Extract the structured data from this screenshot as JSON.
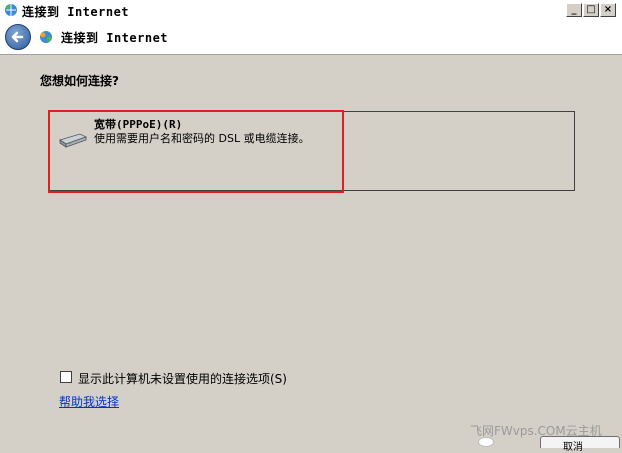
{
  "window": {
    "title": "连接到 Internet",
    "minimize": "_",
    "maximize": "□",
    "close": "×"
  },
  "nav": {
    "title": "连接到 Internet",
    "back_icon": "back-arrow-icon"
  },
  "main": {
    "question": "您想如何连接?",
    "option": {
      "title": "宽带(PPPoE)(R)",
      "description": "使用需要用户名和密码的 DSL 或电缆连接。",
      "icon": "modem-icon"
    },
    "checkbox": {
      "label": "显示此计算机未设置使用的连接选项(S)",
      "checked": false
    },
    "help_link": "帮助我选择"
  },
  "watermark": "飞网FWvps.COM云主机",
  "button": {
    "label": "取消"
  },
  "colors": {
    "highlight": "#e02020",
    "link": "#0033cc",
    "background": "#d4d0c8"
  }
}
